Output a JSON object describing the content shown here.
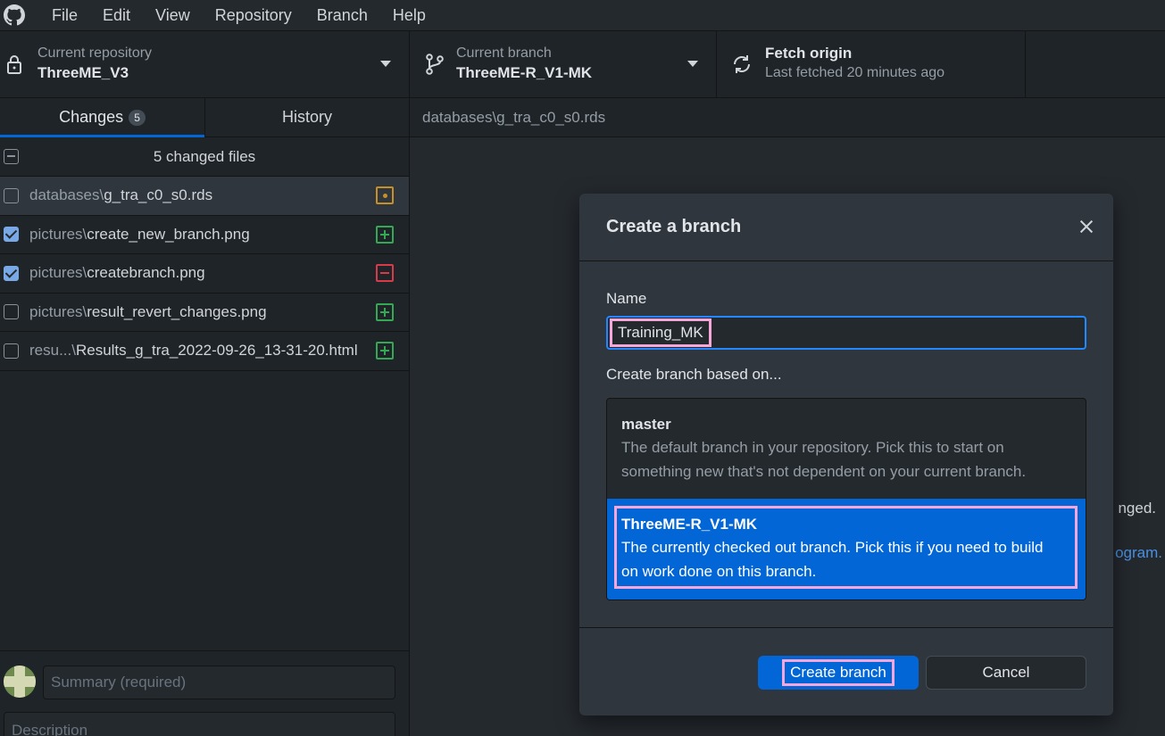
{
  "menu": {
    "items": [
      {
        "label": "File"
      },
      {
        "label": "Edit"
      },
      {
        "label": "View"
      },
      {
        "label": "Repository"
      },
      {
        "label": "Branch"
      },
      {
        "label": "Help"
      }
    ]
  },
  "toolbar": {
    "repo_label": "Current repository",
    "repo_value": "ThreeME_V3",
    "branch_label": "Current branch",
    "branch_value": "ThreeME-R_V1-MK",
    "fetch_label": "Fetch origin",
    "fetch_value": "Last fetched 20 minutes ago"
  },
  "sidebar": {
    "tabs": [
      {
        "label": "Changes",
        "badge": "5"
      },
      {
        "label": "History"
      }
    ],
    "changes_header": "5 changed files",
    "files": [
      {
        "dir": "databases\\",
        "name": "g_tra_c0_s0.rds",
        "status": "modified",
        "checked": false
      },
      {
        "dir": "pictures\\",
        "name": "create_new_branch.png",
        "status": "added",
        "checked": true
      },
      {
        "dir": "pictures\\",
        "name": "createbranch.png",
        "status": "deleted",
        "checked": true
      },
      {
        "dir": "pictures\\",
        "name": "result_revert_changes.png",
        "status": "added",
        "checked": false
      },
      {
        "dir": "resu...\\",
        "name": "Results_g_tra_2022-09-26_13-31-20.html",
        "status": "added",
        "checked": false
      }
    ],
    "summary_placeholder": "Summary (required)",
    "description_placeholder": "Description"
  },
  "main": {
    "header_path": "databases\\g_tra_c0_s0.rds",
    "bg_text_1": "nged.",
    "bg_text_2": "ogram."
  },
  "dialog": {
    "title": "Create a branch",
    "name_label": "Name",
    "name_value": "Training_MK",
    "based_on_label": "Create branch based on...",
    "options": [
      {
        "name": "master",
        "desc_line1": "The default branch in your repository. Pick this to start on",
        "desc_line2": "something new that's not dependent on your current branch."
      },
      {
        "name": "ThreeME-R_V1-MK",
        "desc_line1": "The currently checked out branch. Pick this if you need to build",
        "desc_line2": "on work done on this branch."
      }
    ],
    "create_label": "Create branch",
    "cancel_label": "Cancel"
  },
  "colors": {
    "accent": "#0366d6",
    "highlight": "#f6a6d8",
    "modified": "#c69026",
    "added": "#34a853",
    "deleted": "#d73a49"
  }
}
